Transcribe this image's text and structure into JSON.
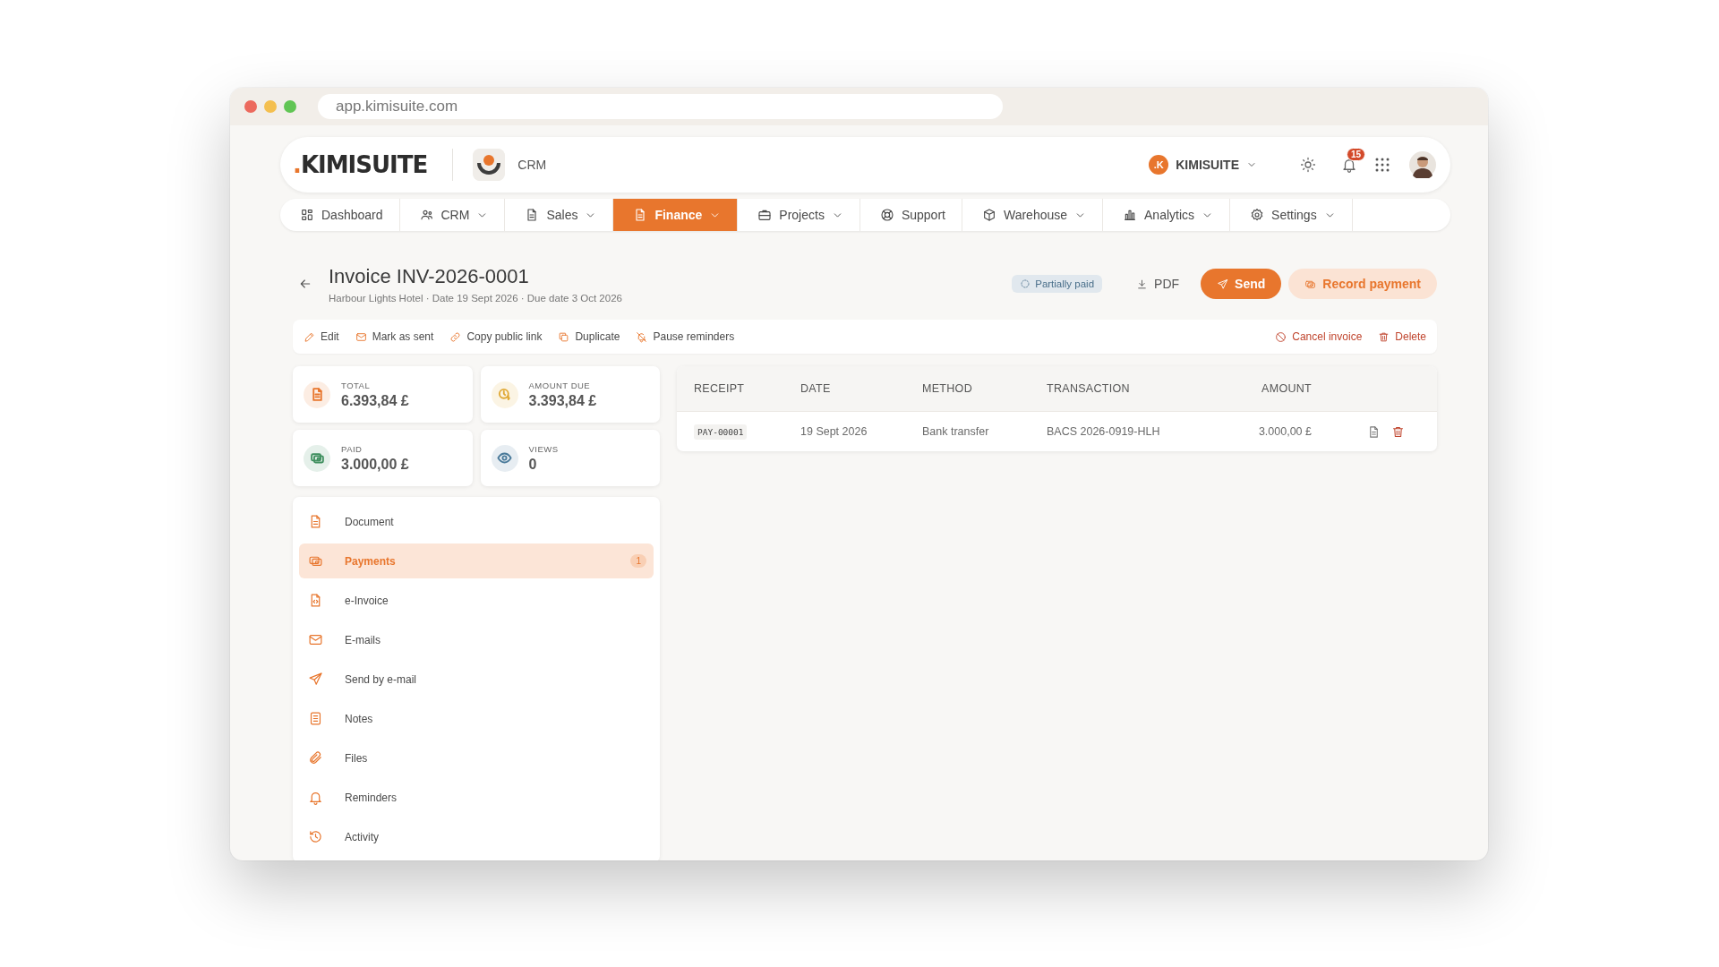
{
  "browser": {
    "url": "app.kimisuite.com"
  },
  "header": {
    "logo_dot": ".",
    "logo": "KIMISUITE",
    "module": "CRM",
    "workspace_initial": ".K",
    "workspace": "KIMISUITE",
    "notification_count": "15"
  },
  "nav": [
    {
      "label": "Dashboard",
      "selected": false,
      "dropdown": false
    },
    {
      "label": "CRM",
      "selected": false,
      "dropdown": true
    },
    {
      "label": "Sales",
      "selected": false,
      "dropdown": true
    },
    {
      "label": "Finance",
      "selected": true,
      "dropdown": true
    },
    {
      "label": "Projects",
      "selected": false,
      "dropdown": true
    },
    {
      "label": "Support",
      "selected": false,
      "dropdown": false
    },
    {
      "label": "Warehouse",
      "selected": false,
      "dropdown": true
    },
    {
      "label": "Analytics",
      "selected": false,
      "dropdown": true
    },
    {
      "label": "Settings",
      "selected": false,
      "dropdown": true
    }
  ],
  "invoice": {
    "title": "Invoice INV-2026-0001",
    "subtitle": "Harbour Lights Hotel · Date 19 Sept 2026 · Due date 3 Oct 2026",
    "status": "Partially paid",
    "buttons": [
      {
        "label": "PDF",
        "kind": "plain"
      },
      {
        "label": "Send",
        "kind": "primary"
      },
      {
        "label": "Record payment",
        "kind": "soft"
      }
    ]
  },
  "actions": [
    {
      "label": "Edit",
      "kind": "normal"
    },
    {
      "label": "Mark as sent",
      "kind": "normal"
    },
    {
      "label": "Copy public link",
      "kind": "normal"
    },
    {
      "label": "Duplicate",
      "kind": "normal"
    },
    {
      "label": "Pause reminders",
      "kind": "normal"
    },
    {
      "label": "Cancel invoice",
      "kind": "danger"
    },
    {
      "label": "Delete",
      "kind": "danger"
    }
  ],
  "stats": [
    {
      "label": "TOTAL",
      "value": "6.393,84 £",
      "color": "#e8762d"
    },
    {
      "label": "AMOUNT DUE",
      "value": "3.393,84 £",
      "color": "#e0a935"
    },
    {
      "label": "PAID",
      "value": "3.000,00 £",
      "color": "#3f8f5f"
    },
    {
      "label": "VIEWS",
      "value": "0",
      "color": "#4a7a9a"
    }
  ],
  "menu": [
    {
      "label": "Document",
      "selected": false
    },
    {
      "label": "Payments",
      "selected": true,
      "count": "1"
    },
    {
      "label": "e-Invoice",
      "selected": false
    },
    {
      "label": "E-mails",
      "selected": false
    },
    {
      "label": "Send by e-mail",
      "selected": false
    },
    {
      "label": "Notes",
      "selected": false
    },
    {
      "label": "Files",
      "selected": false
    },
    {
      "label": "Reminders",
      "selected": false
    },
    {
      "label": "Activity",
      "selected": false
    }
  ],
  "payments": {
    "columns": [
      "RECEIPT",
      "DATE",
      "METHOD",
      "TRANSACTION",
      "AMOUNT"
    ],
    "rows": [
      {
        "receipt": "PAY-00001",
        "date": "19 Sept 2026",
        "method": "Bank transfer",
        "transaction": "BACS 2026-0919-HLH",
        "amount": "3.000,00 £"
      }
    ]
  }
}
